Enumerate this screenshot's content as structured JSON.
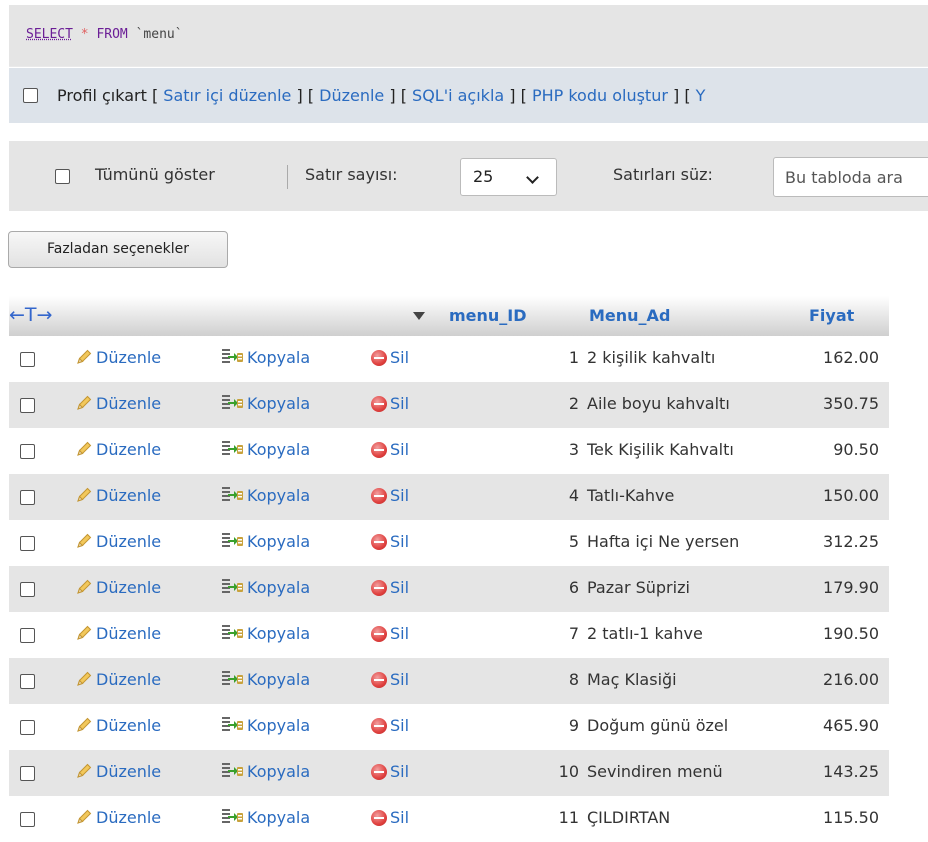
{
  "query": {
    "select": "SELECT",
    "star": "*",
    "from": "FROM",
    "table": "`menu`"
  },
  "profile_bar": {
    "profile_label": "Profil çıkart",
    "links": [
      "Satır içi düzenle",
      "Düzenle",
      "SQL'i açıkla",
      "PHP kodu oluştur",
      "Y"
    ]
  },
  "nav": {
    "show_all_label": "Tümünü göster",
    "row_count_label": "Satır sayısı:",
    "row_count_value": "25",
    "filter_label": "Satırları süz:",
    "filter_placeholder": "Bu tabloda ara"
  },
  "extra_options_button": "Fazladan seçenekler",
  "table": {
    "arrows": "←T→",
    "columns": [
      "menu_ID",
      "Menu_Ad",
      "Fiyat"
    ],
    "actions": {
      "edit": "Düzenle",
      "copy": "Kopyala",
      "delete": "Sil"
    },
    "rows": [
      {
        "id": "1",
        "name": "2 kişilik kahvaltı",
        "price": "162.00"
      },
      {
        "id": "2",
        "name": "Aile boyu kahvaltı",
        "price": "350.75"
      },
      {
        "id": "3",
        "name": "Tek Kişilik Kahvaltı",
        "price": "90.50"
      },
      {
        "id": "4",
        "name": "Tatlı-Kahve",
        "price": "150.00"
      },
      {
        "id": "5",
        "name": "Hafta içi Ne yersen",
        "price": "312.25"
      },
      {
        "id": "6",
        "name": "Pazar Süprizi",
        "price": "179.90"
      },
      {
        "id": "7",
        "name": "2 tatlı-1 kahve",
        "price": "190.50"
      },
      {
        "id": "8",
        "name": "Maç Klasiği",
        "price": "216.00"
      },
      {
        "id": "9",
        "name": "Doğum günü özel",
        "price": "465.90"
      },
      {
        "id": "10",
        "name": "Sevindiren menü",
        "price": "143.25"
      },
      {
        "id": "11",
        "name": "ÇILDIRTAN",
        "price": "115.50"
      }
    ]
  },
  "colors": {
    "link": "#2a6bc0",
    "stripe": "#e5e5e5",
    "sql_keyword": "#6b1e96"
  }
}
